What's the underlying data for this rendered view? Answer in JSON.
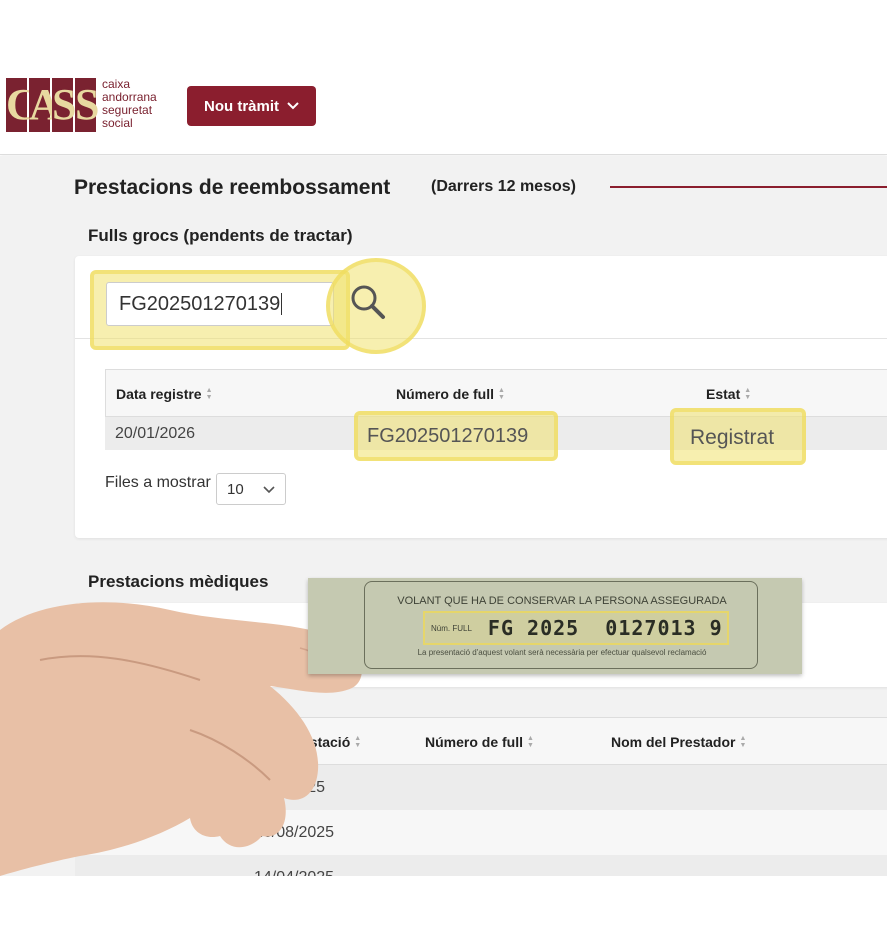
{
  "header": {
    "logo_letters": [
      "C",
      "A",
      "S",
      "S"
    ],
    "logo_text": [
      "caixa",
      "andorrana",
      "seguretat",
      "social"
    ],
    "new_procedure_label": "Nou tràmit"
  },
  "page": {
    "title": "Prestacions de reembossament",
    "subtitle": "(Darrers 12 mesos)"
  },
  "yellow_sheets": {
    "section_title": "Fulls grocs (pendents de tractar)",
    "search_value": "FG202501270139",
    "columns": [
      "Data registre",
      "Número de full",
      "Estat"
    ],
    "rows": [
      {
        "date": "20/01/2026",
        "number": "FG202501270139",
        "status": "Registrat"
      }
    ],
    "rows_to_show_label": "Files a mostrar",
    "rows_to_show_value": "10"
  },
  "medical": {
    "section_title": "Prestacions mèdiques",
    "columns": [
      "prestació",
      "Número de full",
      "Nom del Prestador"
    ],
    "rows": [
      "/2025",
      "26/08/2025",
      "14/04/2025"
    ]
  },
  "ticket": {
    "top_text": "VOLANT QUE HA DE CONSERVAR LA PERSONA ASSEGURADA",
    "num_label": "Núm. FULL",
    "num_value": "FG 2025  0127013 9",
    "bottom_text": "La presentació d'aquest volant serà necessària per efectuar qualsevol reclamació"
  },
  "colors": {
    "brand": "#8b1e2e",
    "highlight": "#f0e16e",
    "ticket": "#c5c9b1"
  }
}
